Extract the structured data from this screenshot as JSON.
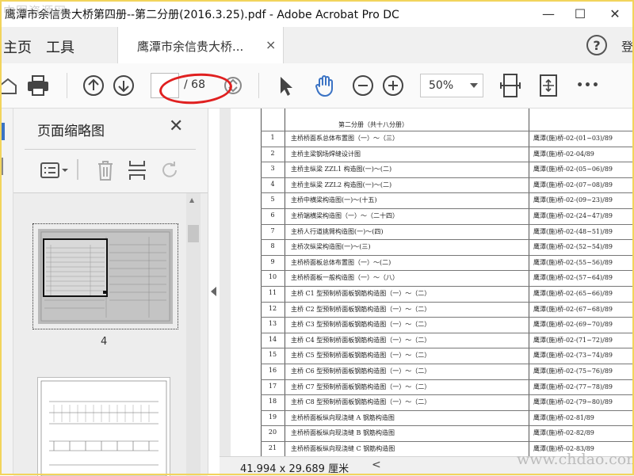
{
  "window": {
    "title": "鹰潭市余信贵大桥第四册--第二分册(2016.3.25).pdf - Adobe Acrobat Pro DC",
    "min": "—",
    "max": "☐",
    "close": "✕"
  },
  "nav": {
    "home": "主页",
    "tools": "工具",
    "doc_tab": "鹰潭市余信贵大桥...",
    "tab_close": "×",
    "help": "?",
    "signin_partial": "登"
  },
  "toolbar": {
    "page_current": "",
    "page_total": "/ 68",
    "zoom": "50%",
    "more": "•••"
  },
  "panel": {
    "title": "页面缩略图",
    "close": "✕",
    "thumb_label": "4"
  },
  "document": {
    "header": "第二分册（共十八分册）",
    "rows": [
      {
        "no": "1",
        "name": "主桥桥面系总体布置图（一）～（三）",
        "code": "鹰潭(施)桥-02-(01~03)/89"
      },
      {
        "no": "2",
        "name": "主桥主梁钢场焊缝设计图",
        "code": "鹰潭(施)桥-02-04/89"
      },
      {
        "no": "3",
        "name": "主桥主纵梁 ZZL1 构造图(一)～(二)",
        "code": "鹰潭(施)桥-02-(05~06)/89"
      },
      {
        "no": "4",
        "name": "主桥主纵梁 ZZL2 构造图(一)～(二)",
        "code": "鹰潭(施)桥-02-(07~08)/89"
      },
      {
        "no": "5",
        "name": "主桥中横梁构造图(一)～(十五)",
        "code": "鹰潭(施)桥-02-(09~23)/89"
      },
      {
        "no": "6",
        "name": "主桥端横梁构造图（一）～（二十四）",
        "code": "鹰潭(施)桥-02-(24~47)/89"
      },
      {
        "no": "7",
        "name": "主桥人行道挑臂构造图(一)～(四)",
        "code": "鹰潭(施)桥-02-(48~51)/89"
      },
      {
        "no": "8",
        "name": "主桥次纵梁构造图(一)～(三)",
        "code": "鹰潭(施)桥-02-(52~54)/89"
      },
      {
        "no": "9",
        "name": "主桥桥面板总体布置图（一）～(二)",
        "code": "鹰潭(施)桥-02-(55~56)/89"
      },
      {
        "no": "10",
        "name": "主桥桥面板一般构造图（一）～（八）",
        "code": "鹰潭(施)桥-02-(57~64)/89"
      },
      {
        "no": "11",
        "name": "主桥 C1 型预制桥面板钢筋构造图（一）～（二）",
        "code": "鹰潭(施)桥-02-(65~66)/89"
      },
      {
        "no": "12",
        "name": "主桥 C2 型预制桥面板钢筋构造图（一）～（二）",
        "code": "鹰潭(施)桥-02-(67~68)/89"
      },
      {
        "no": "13",
        "name": "主桥 C3 型预制桥面板钢筋构造图（一）～（二）",
        "code": "鹰潭(施)桥-02-(69~70)/89"
      },
      {
        "no": "14",
        "name": "主桥 C4 型预制桥面板钢筋构造图（一）～（二）",
        "code": "鹰潭(施)桥-02-(71~72)/89"
      },
      {
        "no": "15",
        "name": "主桥 C5 型预制桥面板钢筋构造图（一）～（二）",
        "code": "鹰潭(施)桥-02-(73~74)/89"
      },
      {
        "no": "16",
        "name": "主桥 C6 型预制桥面板钢筋构造图（一）～（二）",
        "code": "鹰潭(施)桥-02-(75~76)/89"
      },
      {
        "no": "17",
        "name": "主桥 C7 型预制桥面板钢筋构造图（一）～（二）",
        "code": "鹰潭(施)桥-02-(77~78)/89"
      },
      {
        "no": "18",
        "name": "主桥 C8 型预制桥面板钢筋构造图（一）～（二）",
        "code": "鹰潭(施)桥-02-(79~80)/89"
      },
      {
        "no": "19",
        "name": "主桥桥面板纵向现浇缝 A 钢筋构造图",
        "code": "鹰潭(施)桥-02-81/89"
      },
      {
        "no": "20",
        "name": "主桥桥面板纵向现浇缝 B 钢筋构造图",
        "code": "鹰潭(施)桥-02-82/89"
      },
      {
        "no": "21",
        "name": "主桥桥面板纵向现浇缝 C 钢筋构造图",
        "code": "鹰潭(施)桥-02-83/89"
      }
    ]
  },
  "status": {
    "dimensions": "41.994 x 29.689 厘米",
    "scroll_left": "<"
  },
  "watermarks": {
    "top_left": "中图资源网",
    "bottom_right": "www.chdao.com"
  },
  "colors": {
    "accent": "#3b73c4",
    "annotation": "#e02020",
    "frame": "#f2d45c"
  }
}
